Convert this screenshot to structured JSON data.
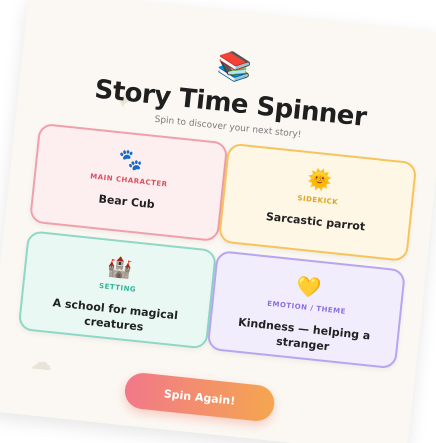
{
  "app": {
    "icon": "books-icon",
    "icon_glyph": "📚",
    "title": "Story Time Spinner",
    "subtitle": "Spin to discover your next story!"
  },
  "cards": {
    "main": {
      "icon": "paw-icon",
      "glyph": "🐾",
      "label": "MAIN CHARACTER",
      "value": "Bear Cub",
      "accent": "#d95161"
    },
    "sidekick": {
      "icon": "sun-icon",
      "glyph": "🌞",
      "label": "SIDEKICK",
      "value": "Sarcastic parrot",
      "accent": "#e3a21a"
    },
    "setting": {
      "icon": "castle-icon",
      "glyph": "🏰",
      "label": "SETTING",
      "value": "A school for magical creatures",
      "accent": "#2fb596"
    },
    "emotion": {
      "icon": "heart-icon",
      "glyph": "💛",
      "label": "EMOTION / THEME",
      "value": "Kindness — helping a stranger",
      "accent": "#8a6fe0"
    }
  },
  "actions": {
    "spin_label": "Spin Again!"
  }
}
